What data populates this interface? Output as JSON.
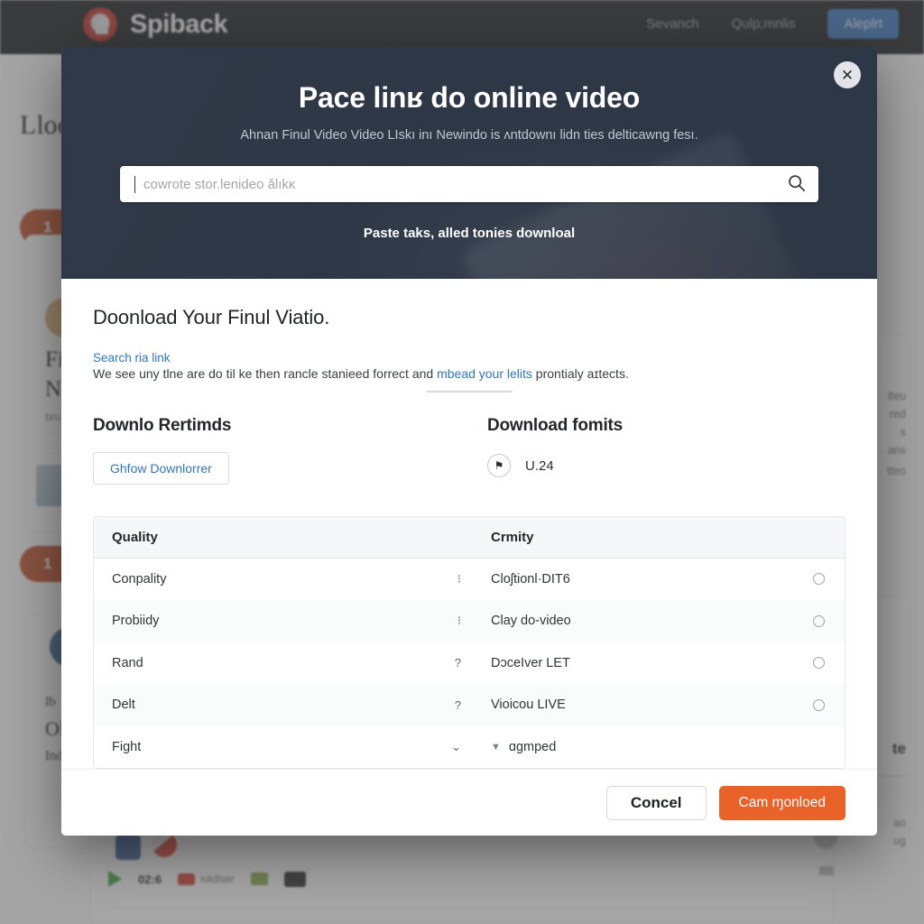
{
  "background": {
    "brand": "Spiback",
    "nav": [
      {
        "label": "Sevanch"
      },
      {
        "label": "Qulp;mnlis"
      }
    ],
    "nav_button": "Aleplrt",
    "page_heading": "Lloou",
    "badges": [
      "1",
      "1"
    ],
    "card_title_line1": "Fii",
    "card_title_line2": "Nc",
    "card_small": "bru",
    "profile_line1": "lb",
    "profile_line2": "Ol",
    "profile_line3": "Ind",
    "right_snippets": [
      "lteu",
      "red",
      "s",
      "ans",
      "tteo"
    ],
    "right_word": "te",
    "right_bottom": [
      "ao",
      "ug"
    ],
    "media_time": "02:6",
    "media_label": "iuldlser"
  },
  "modal": {
    "close_icon": "close-icon",
    "title": "Pace linʁ do online video",
    "subtitle": "Ahnan Finul Video Video LIskı inı Newindo is ʌntdownı lidn ties delticawng fesı.",
    "search": {
      "placeholder": "cowrote stor.lenideo ǎlıkκ",
      "value": "",
      "icon": "search-icon"
    },
    "hero_note": "Paste taks, alled tonies downloal",
    "body": {
      "section_title": "Doonload Your Finul Viatio.",
      "link": "Search ria link",
      "paragraph_pre": "We see uny tlne are do til ke then rancle stanieed forrect and ",
      "paragraph_link": "mbead your lelits",
      "paragraph_post": " prontialy aɪtects."
    },
    "left_column": {
      "heading": "Downlo Rertimds",
      "button": "Ghfow Downlorrer"
    },
    "right_column": {
      "heading": "Download fomits",
      "format_icon": "flag-icon",
      "format_label": "U.24"
    },
    "table": {
      "headers": [
        "Quality",
        "Crmity"
      ],
      "rows": [
        {
          "quality": "Conpality",
          "quality_mark": "⁝",
          "format": "Cloʃtionl·DIT6"
        },
        {
          "quality": "Probiidy",
          "quality_mark": "⁝",
          "format": "Clay do-video"
        },
        {
          "quality": "Rand",
          "quality_mark": "?",
          "format": "DɔceIver LET"
        },
        {
          "quality": "Delt",
          "quality_mark": "?",
          "format": "Vioicou LIVE"
        }
      ],
      "last_row": {
        "quality": "Fight",
        "quality_mark": "⌄",
        "format": "ɑgmped",
        "format_caret": "▼"
      }
    },
    "footer": {
      "cancel": "Concel",
      "confirm": "Cam ɱonloed"
    }
  },
  "colors": {
    "accent_orange": "#e8622a",
    "modal_header": "#303a49",
    "link_blue": "#3076bb",
    "nav_button_blue": "#2f6fbd",
    "badge_orange": "#c0451d"
  }
}
